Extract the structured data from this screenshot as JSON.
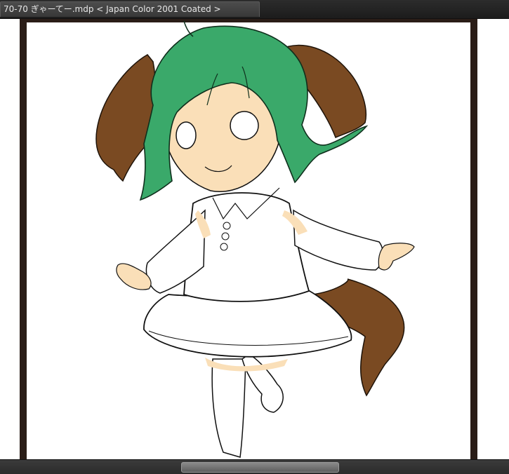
{
  "document": {
    "tab_title": "70-70 ぎゃーてー.mdp < Japan Color 2001 Coated >"
  },
  "colors": {
    "hair": "#3aa96a",
    "ears": "#7a4a22",
    "skin": "#fadfb8",
    "frame": "#2a1d17",
    "chrome": "#1b1b1b"
  },
  "canvas": {
    "artwork": "chibi character line art with green hair, brown dog ears and tail"
  }
}
